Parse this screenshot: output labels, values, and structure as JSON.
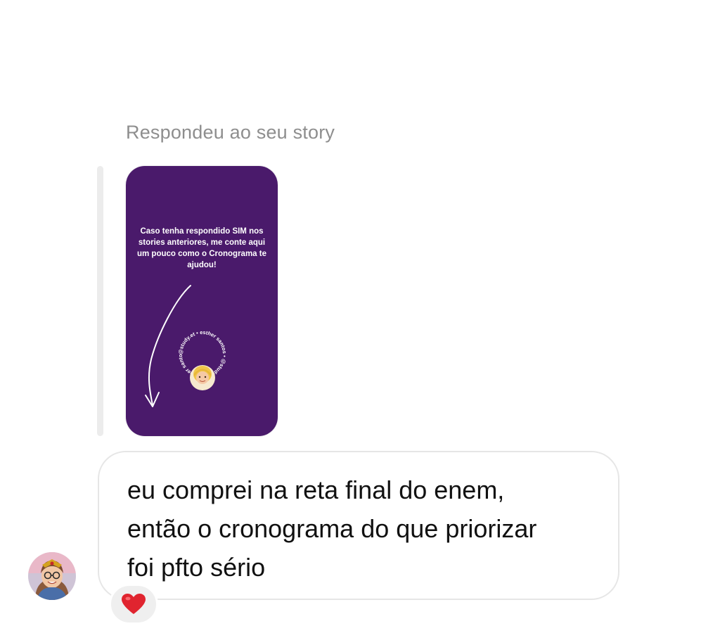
{
  "thread": {
    "reply_label": "Respondeu ao seu story"
  },
  "story": {
    "text": "Caso tenha respondido SIM nos stories anteriores, me conte aqui um pouco como o Cronograma te ajudou!",
    "badge_text": "@study.et • esther santos • @study.et • esther santos •",
    "background": "#4a1a6b",
    "icons": [
      "curved-arrow-icon",
      "memoji-avatar-icon"
    ]
  },
  "message": {
    "lines": [
      "eu comprei na reta final do enem,",
      "então o cronograma do que priorizar",
      "foi pfto sério"
    ],
    "reaction": "❤️"
  }
}
